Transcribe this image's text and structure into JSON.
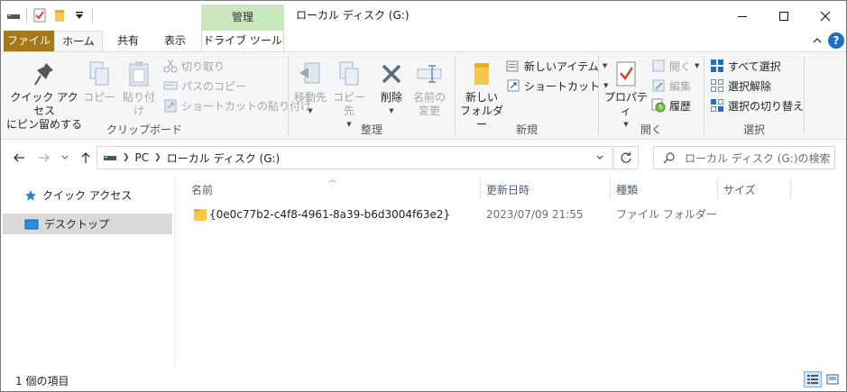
{
  "titlebar": {
    "context_tab": "管理",
    "title": "ローカル ディスク (G:)",
    "minimize": "—",
    "maximize": "☐",
    "close": "✕"
  },
  "tabs": {
    "file": "ファイル",
    "home": "ホーム",
    "share": "共有",
    "view": "表示",
    "drive_tools": "ドライブ ツール",
    "help": "?"
  },
  "ribbon": {
    "clipboard": {
      "label": "クリップボード",
      "pin_line1": "クイック アクセス",
      "pin_line2": "にピン留めする",
      "copy": "コピー",
      "paste": "貼り付け",
      "cut": "切り取り",
      "copy_path": "パスのコピー",
      "paste_shortcut": "ショートカットの貼り付け"
    },
    "organize": {
      "label": "整理",
      "move_to": "移動先",
      "copy_to": "コピー先",
      "delete": "削除",
      "rename_line1": "名前の",
      "rename_line2": "変更"
    },
    "new": {
      "label": "新規",
      "new_folder_line1": "新しい",
      "new_folder_line2": "フォルダー",
      "new_item": "新しいアイテム",
      "shortcut": "ショートカット"
    },
    "open": {
      "label": "開く",
      "properties": "プロパティ",
      "open": "開く",
      "edit": "編集",
      "history": "履歴"
    },
    "select": {
      "label": "選択",
      "select_all": "すべて選択",
      "select_none": "選択解除",
      "invert": "選択の切り替え"
    }
  },
  "address": {
    "path": [
      "PC",
      "ローカル ディスク (G:)"
    ],
    "search_placeholder": "ローカル ディスク (G:)の検索"
  },
  "navpane": {
    "items": [
      {
        "label": "クイック アクセス",
        "icon": "star-icon"
      },
      {
        "label": "デスクトップ",
        "icon": "desktop-icon"
      }
    ]
  },
  "filelist": {
    "columns": [
      "名前",
      "更新日時",
      "種類",
      "サイズ"
    ],
    "rows": [
      {
        "name": "{0e0c77b2-c4f8-4961-8a39-b6d3004f63e2}",
        "modified": "2023/07/09 21:55",
        "type": "ファイル フォルダー",
        "size": ""
      }
    ]
  },
  "status": {
    "count": "1 個の項目"
  },
  "colors": {
    "file_tab": "#a57a1a",
    "context_tab": "#c9e7bf",
    "accent": "#1f6fbf",
    "folder": "#f5c84c"
  }
}
